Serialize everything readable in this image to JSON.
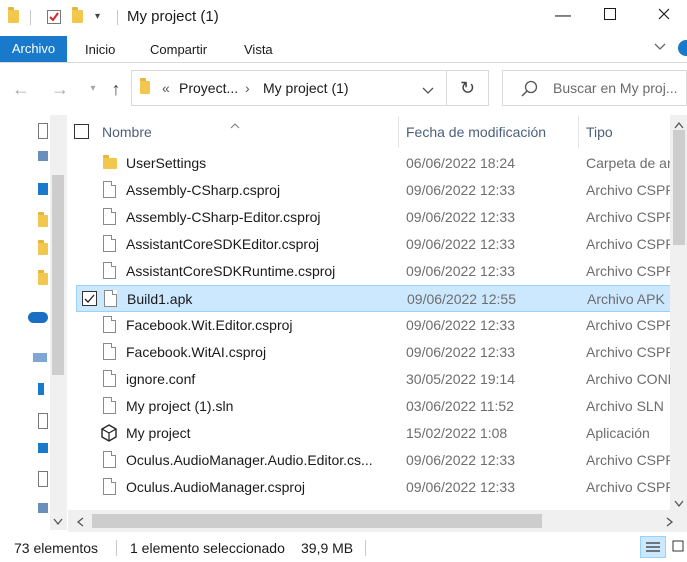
{
  "window": {
    "title": "My project (1)",
    "minimize_icon": "minimize-icon",
    "maximize_icon": "maximize-icon",
    "close_icon": "close-icon"
  },
  "ribbon": {
    "tabs": [
      "Archivo",
      "Inicio",
      "Compartir",
      "Vista"
    ],
    "active_tab": "Archivo",
    "accent": "#1979ca"
  },
  "address": {
    "breadcrumb": [
      "«",
      "Proyect...",
      "My project (1)"
    ],
    "search_placeholder": "Buscar en My proj..."
  },
  "columns": {
    "name": "Nombre",
    "date": "Fecha de modificación",
    "type": "Tipo"
  },
  "files": [
    {
      "name": "UserSettings",
      "date": "06/06/2022 18:24",
      "type": "Carpeta de ar",
      "icon": "folder-icon"
    },
    {
      "name": "Assembly-CSharp.csproj",
      "date": "09/06/2022 12:33",
      "type": "Archivo CSPRO",
      "icon": "file-icon"
    },
    {
      "name": "Assembly-CSharp-Editor.csproj",
      "date": "09/06/2022 12:33",
      "type": "Archivo CSPRO",
      "icon": "file-icon"
    },
    {
      "name": "AssistantCoreSDKEditor.csproj",
      "date": "09/06/2022 12:33",
      "type": "Archivo CSPRO",
      "icon": "file-icon"
    },
    {
      "name": "AssistantCoreSDKRuntime.csproj",
      "date": "09/06/2022 12:33",
      "type": "Archivo CSPRO",
      "icon": "file-icon"
    },
    {
      "name": "Build1.apk",
      "date": "09/06/2022 12:55",
      "type": "Archivo APK",
      "icon": "file-icon",
      "selected": true
    },
    {
      "name": "Facebook.Wit.Editor.csproj",
      "date": "09/06/2022 12:33",
      "type": "Archivo CSPRO",
      "icon": "file-icon"
    },
    {
      "name": "Facebook.WitAI.csproj",
      "date": "09/06/2022 12:33",
      "type": "Archivo CSPRO",
      "icon": "file-icon"
    },
    {
      "name": "ignore.conf",
      "date": "30/05/2022 19:14",
      "type": "Archivo CONF",
      "icon": "file-icon"
    },
    {
      "name": "My project (1).sln",
      "date": "03/06/2022 11:52",
      "type": "Archivo SLN",
      "icon": "file-icon"
    },
    {
      "name": "My project",
      "date": "15/02/2022 1:08",
      "type": "Aplicación",
      "icon": "unity-icon"
    },
    {
      "name": "Oculus.AudioManager.Audio.Editor.cs...",
      "date": "09/06/2022 12:33",
      "type": "Archivo CSPRO",
      "icon": "file-icon"
    },
    {
      "name": "Oculus.AudioManager.csproj",
      "date": "09/06/2022 12:33",
      "type": "Archivo CSPRO",
      "icon": "file-icon"
    }
  ],
  "status": {
    "count": "73 elementos",
    "selection": "1 elemento seleccionado",
    "size": "39,9 MB"
  }
}
